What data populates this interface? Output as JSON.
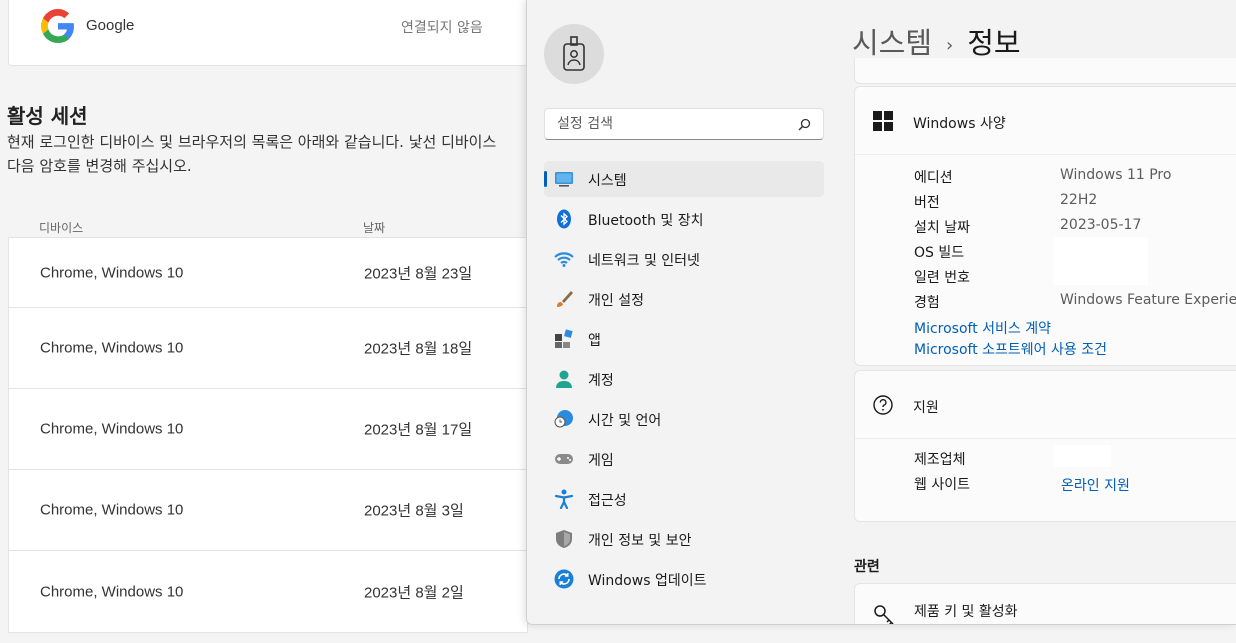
{
  "web": {
    "google_label": "Google",
    "google_status": "연결되지 않음",
    "sessions_title": "활성 세션",
    "sessions_desc_line1": "현재 로그인한 디바이스 및 브라우저의 목록은 아래와 같습니다. 낯선 디바이스",
    "sessions_desc_line2": "다음 암호를 변경해 주십시오.",
    "col_device": "디바이스",
    "col_date": "날짜",
    "rows": [
      {
        "device": "Chrome, Windows 10",
        "date": "2023년 8월 23일"
      },
      {
        "device": "Chrome, Windows 10",
        "date": "2023년 8월 18일"
      },
      {
        "device": "Chrome, Windows 10",
        "date": "2023년 8월 17일"
      },
      {
        "device": "Chrome, Windows 10",
        "date": "2023년 8월 3일"
      },
      {
        "device": "Chrome, Windows 10",
        "date": "2023년 8월 2일"
      }
    ]
  },
  "settings": {
    "search_placeholder": "설정 검색",
    "nav": [
      {
        "label": "시스템",
        "icon": "system-icon"
      },
      {
        "label": "Bluetooth 및 장치",
        "icon": "bluetooth-icon"
      },
      {
        "label": "네트워크 및 인터넷",
        "icon": "wifi-icon"
      },
      {
        "label": "개인 설정",
        "icon": "brush-icon"
      },
      {
        "label": "앱",
        "icon": "apps-icon"
      },
      {
        "label": "계정",
        "icon": "account-icon"
      },
      {
        "label": "시간 및 언어",
        "icon": "time-language-icon"
      },
      {
        "label": "게임",
        "icon": "gamepad-icon"
      },
      {
        "label": "접근성",
        "icon": "accessibility-icon"
      },
      {
        "label": "개인 정보 및 보안",
        "icon": "shield-icon"
      },
      {
        "label": "Windows 업데이트",
        "icon": "update-icon"
      }
    ],
    "breadcrumb_parent": "시스템",
    "breadcrumb_sep": "›",
    "breadcrumb_current": "정보",
    "spec_title": "Windows 사양",
    "spec": {
      "edition_label": "에디션",
      "edition_value": "Windows 11 Pro",
      "version_label": "버전",
      "version_value": "22H2",
      "install_label": "설치 날짜",
      "install_value": "2023-05-17",
      "build_label": "OS 빌드",
      "serial_label": "일련 번호",
      "experience_label": "경험",
      "experience_value": "Windows Feature Experience",
      "link_services": "Microsoft 서비스 계약",
      "link_license": "Microsoft 소프트웨어 사용 조건"
    },
    "support_title": "지원",
    "support": {
      "maker_label": "제조업체",
      "website_label": "웹 사이트",
      "website_link": "온라인 지원"
    },
    "related_title": "관련",
    "product_key_title": "제품 키 및 활성화"
  },
  "colors": {
    "accent": "#005fb8",
    "nav_active": "#e9e9e9"
  }
}
